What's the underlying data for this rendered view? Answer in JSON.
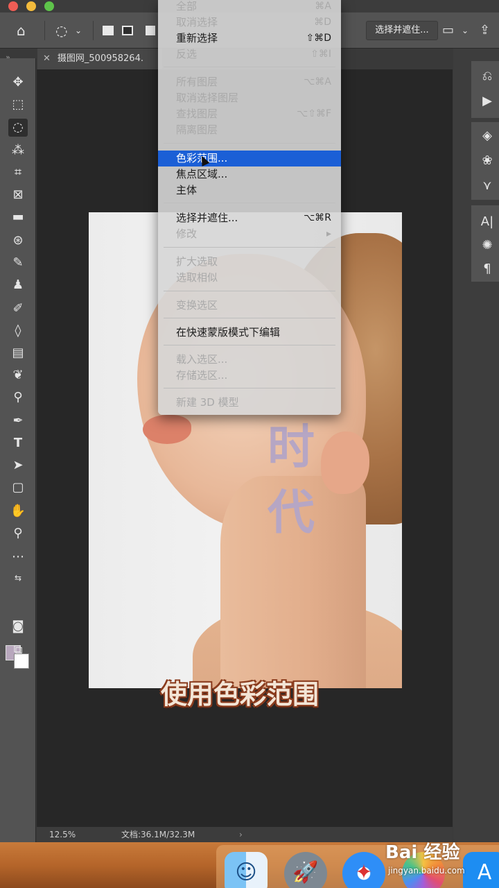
{
  "options_bar": {
    "select_and_mask_label": "选择并遮住..."
  },
  "document_tab": {
    "title": "摄图网_500958264."
  },
  "menu": {
    "items": [
      {
        "label": "全部",
        "shortcut": "⌘A",
        "enabled": false
      },
      {
        "label": "取消选择",
        "shortcut": "⌘D",
        "enabled": false
      },
      {
        "label": "重新选择",
        "shortcut": "⇧⌘D",
        "enabled": true
      },
      {
        "label": "反选",
        "shortcut": "⇧⌘I",
        "enabled": false
      },
      {
        "label": "所有图层",
        "shortcut": "⌥⌘A",
        "enabled": false
      },
      {
        "label": "取消选择图层",
        "shortcut": "",
        "enabled": false
      },
      {
        "label": "查找图层",
        "shortcut": "⌥⇧⌘F",
        "enabled": false
      },
      {
        "label": "隔离图层",
        "shortcut": "",
        "enabled": false
      },
      {
        "label": "色彩范围...",
        "shortcut": "",
        "enabled": true,
        "selected": true
      },
      {
        "label": "焦点区域...",
        "shortcut": "",
        "enabled": true
      },
      {
        "label": "主体",
        "shortcut": "",
        "enabled": true
      },
      {
        "label": "选择并遮住...",
        "shortcut": "⌥⌘R",
        "enabled": true
      },
      {
        "label": "修改",
        "shortcut": "▸",
        "enabled": false
      },
      {
        "label": "扩大选取",
        "shortcut": "",
        "enabled": false
      },
      {
        "label": "选取相似",
        "shortcut": "",
        "enabled": false
      },
      {
        "label": "变换选区",
        "shortcut": "",
        "enabled": false
      },
      {
        "label": "在快速蒙版模式下编辑",
        "shortcut": "",
        "enabled": true
      },
      {
        "label": "载入选区...",
        "shortcut": "",
        "enabled": false
      },
      {
        "label": "存储选区...",
        "shortcut": "",
        "enabled": false
      },
      {
        "label": "新建 3D 模型",
        "shortcut": "",
        "enabled": false
      }
    ]
  },
  "canvas": {
    "overlay_char_1": "时",
    "overlay_char_2": "代",
    "subtitle": "使用色彩范围"
  },
  "status_bar": {
    "zoom": "12.5%",
    "doc_info": "文档:36.1M/32.3M",
    "arrow": "›"
  },
  "tools": {
    "foreground_color": "#b8a7bd",
    "background_color": "#ffffff"
  },
  "watermark": {
    "brand": "Bai  经验",
    "url": "jingyan.baidu.com"
  },
  "colors": {
    "menu_highlight": "#1b5fd6",
    "subtitle_outline": "#8a3b1d"
  }
}
